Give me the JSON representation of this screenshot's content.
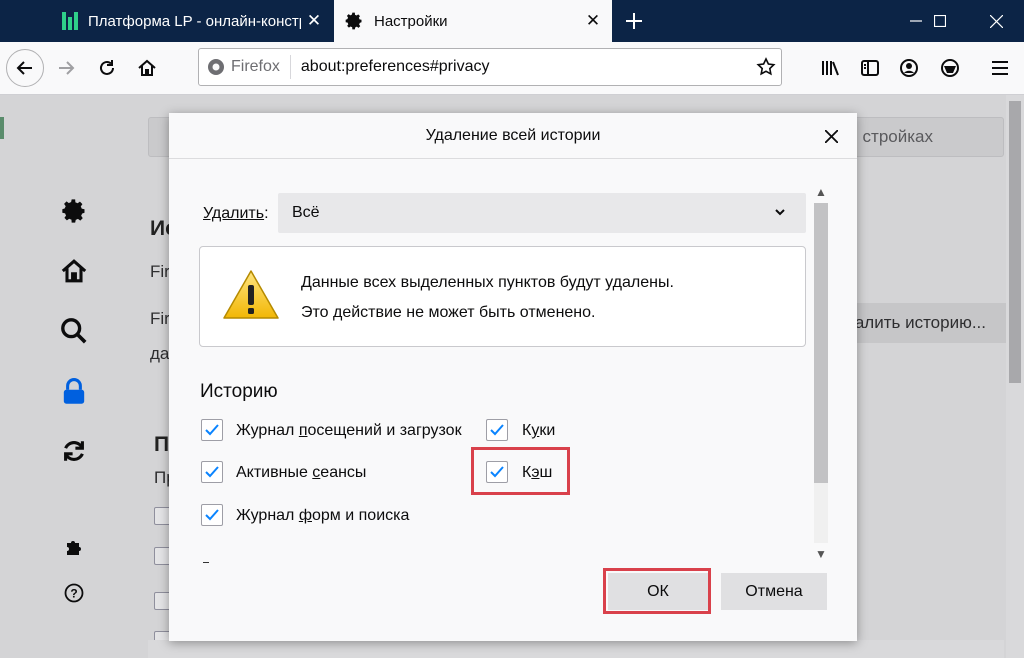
{
  "browser": {
    "tabs": [
      {
        "title": "Платформа LP - онлайн-конструктор"
      },
      {
        "title": "Настройки"
      }
    ],
    "url_identity": "Firefox",
    "url": "about:preferences#privacy"
  },
  "background_page": {
    "search_text": "стройках",
    "heading1": "Ис",
    "text1": "Fir",
    "text2": "Fir",
    "text3": "да",
    "clear_button": "Удалить историю...",
    "heading2": "П",
    "text4": "Пр"
  },
  "dialog": {
    "title": "Удаление всей истории",
    "remove_label_prefix": "Удалить",
    "remove_label_suffix": ":",
    "remove_value": "Всё",
    "warning_line1": "Данные всех выделенных пунктов будут удалены.",
    "warning_line2": "Это действие не может быть отменено.",
    "history_title": "Историю",
    "checkboxes": {
      "browsing_pre": "Журнал ",
      "browsing_u": "п",
      "browsing_post": "осещений и загрузок",
      "cookies_pre": "К",
      "cookies_u": "у",
      "cookies_post": "ки",
      "sessions_pre": "Активные ",
      "sessions_u": "с",
      "sessions_post": "еансы",
      "cache_pre": "К",
      "cache_u": "э",
      "cache_post": "ш",
      "forms_pre": "Журнал ",
      "forms_u": "ф",
      "forms_post": "орм и поиска"
    },
    "ok_label": "ОК",
    "cancel_label": "Отмена"
  },
  "colors": {
    "tabbar": "#0c2446",
    "accent_check": "#0a84ff",
    "highlight": "#d9414b",
    "lock_blue": "#0060df"
  }
}
